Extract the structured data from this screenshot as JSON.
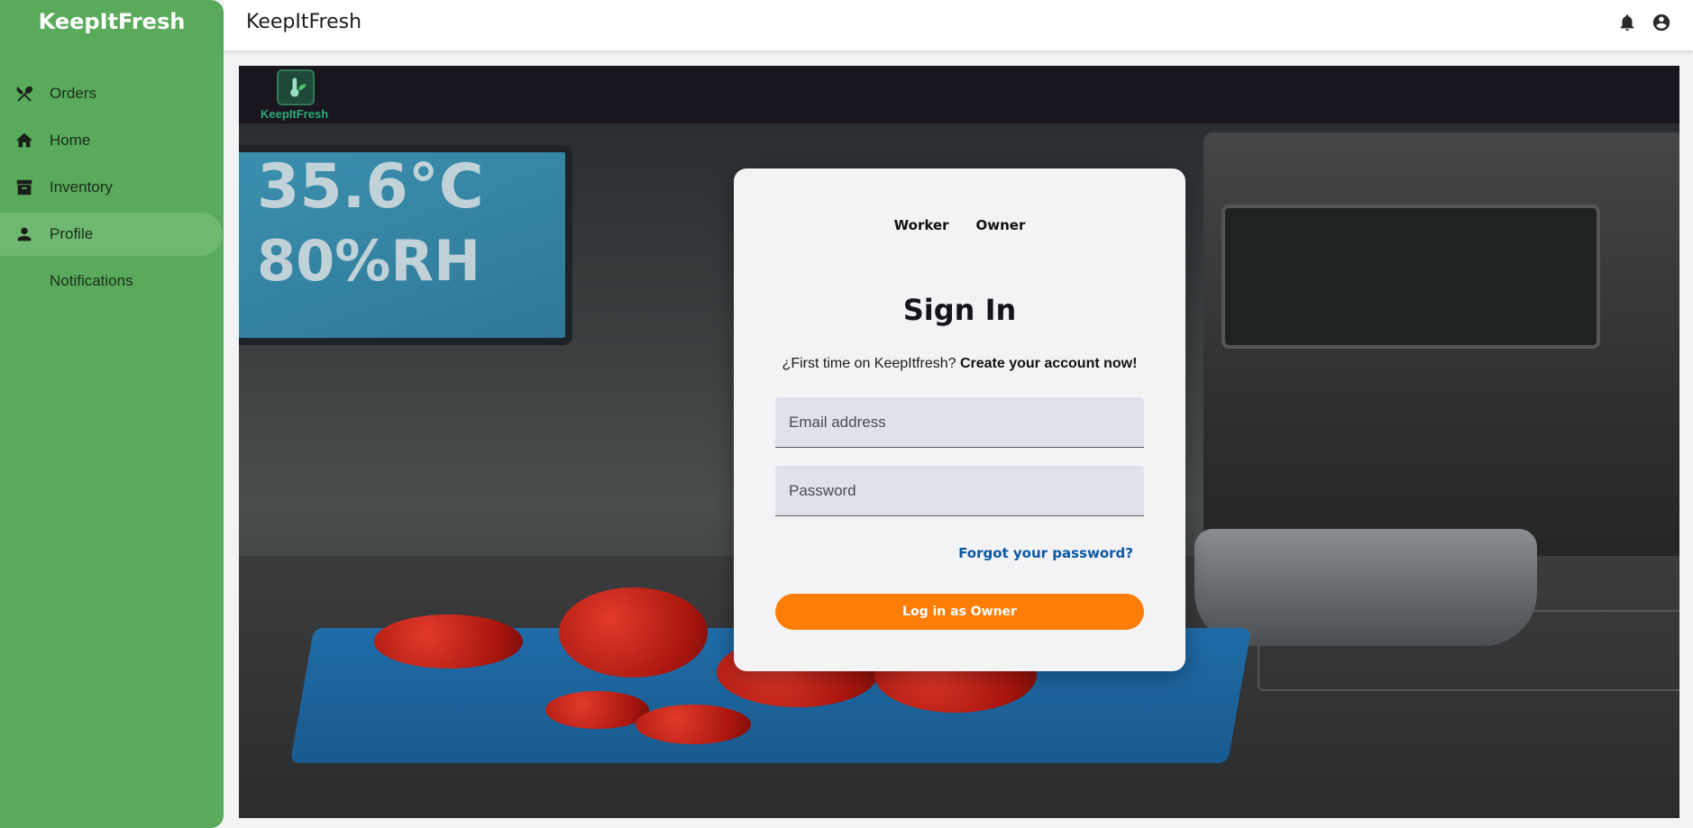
{
  "app": {
    "brand": "KeepItFresh",
    "title": "KeepItFresh"
  },
  "sidebar": {
    "items": [
      {
        "label": "Orders",
        "icon": "utensils-icon"
      },
      {
        "label": "Home",
        "icon": "home-icon"
      },
      {
        "label": "Inventory",
        "icon": "archive-icon"
      },
      {
        "label": "Profile",
        "icon": "person-icon",
        "active": true
      },
      {
        "label": "Notifications",
        "icon": ""
      }
    ]
  },
  "logo": {
    "text": "KeepItFresh"
  },
  "scene": {
    "temperature": "35.6°C",
    "humidity": "80%RH"
  },
  "signin": {
    "roles": [
      "Worker",
      "Owner"
    ],
    "title": "Sign In",
    "prompt": "¿First time on KeepItfresh?",
    "create_link": "Create your account now!",
    "email_placeholder": "Email address",
    "password_placeholder": "Password",
    "forgot": "Forgot your password?",
    "login_button": "Log in as Owner"
  },
  "colors": {
    "sidebar": "#59ab5b",
    "sidebar_active": "#6fb870",
    "accent_button": "#fd7d08",
    "link": "#0b57a4"
  }
}
